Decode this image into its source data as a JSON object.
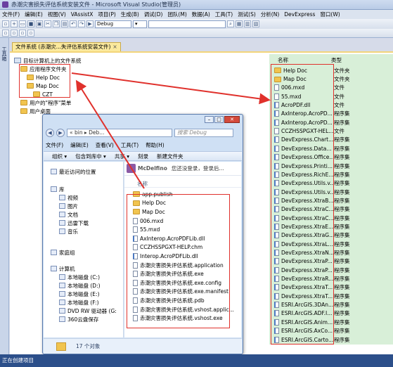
{
  "window": {
    "title": "赤潮灾害损失评估系统安装文件 - Microsoft Visual Studio(管理员)"
  },
  "menu": [
    "文件(F)",
    "编辑(E)",
    "视图(V)",
    "VAssistX",
    "项目(P)",
    "生成(B)",
    "调试(D)",
    "团队(M)",
    "数据(A)",
    "工具(T)",
    "测试(S)",
    "分析(N)",
    "DevExpress",
    "窗口(W)"
  ],
  "toolbar": {
    "config_value": "Debug"
  },
  "dock": {
    "toolbox_label": "工具箱"
  },
  "doc_tab": {
    "label": "文件系统 (赤潮灾...失评估系统安装文件)",
    "close": "×"
  },
  "fs_tree": [
    {
      "label": "目标计算机上的文件系统",
      "level": 0,
      "icon": "computer"
    },
    {
      "label": "应用程序文件夹",
      "level": 1,
      "icon": "folder"
    },
    {
      "label": "Help Doc",
      "level": 2,
      "icon": "folder"
    },
    {
      "label": "Map Doc",
      "level": 2,
      "icon": "folder"
    },
    {
      "label": "CZT",
      "level": 3,
      "icon": "folder"
    },
    {
      "label": "用户的\"程序\"菜单",
      "level": 1,
      "icon": "folder"
    },
    {
      "label": "用户桌面",
      "level": 1,
      "icon": "folder"
    }
  ],
  "right_list": {
    "col_name": "名称",
    "col_type": "类型",
    "rows": [
      {
        "name": "Help Doc",
        "type": "文件夹",
        "icon": "folder"
      },
      {
        "name": "Map Doc",
        "type": "文件夹",
        "icon": "folder"
      },
      {
        "name": "006.mxd",
        "type": "文件",
        "icon": "file"
      },
      {
        "name": "55.mxd",
        "type": "文件",
        "icon": "file"
      },
      {
        "name": "AcroPDF.dll",
        "type": "文件",
        "icon": "dll"
      },
      {
        "name": "AxInterop.AcroPD...",
        "type": "程序集",
        "icon": "dll"
      },
      {
        "name": "AxInterop.AcroPD...",
        "type": "程序集",
        "icon": "dll"
      },
      {
        "name": "CCZHSSPGXT-HEL...",
        "type": "文件",
        "icon": "file"
      },
      {
        "name": "DevExpress.Chart...",
        "type": "程序集",
        "icon": "dll"
      },
      {
        "name": "DevExpress.Data...",
        "type": "程序集",
        "icon": "dll"
      },
      {
        "name": "DevExpress.Office...",
        "type": "程序集",
        "icon": "dll"
      },
      {
        "name": "DevExpress.Printi...",
        "type": "程序集",
        "icon": "dll"
      },
      {
        "name": "DevExpress.RichE...",
        "type": "程序集",
        "icon": "dll"
      },
      {
        "name": "DevExpress.Utils.v...",
        "type": "程序集",
        "icon": "dll"
      },
      {
        "name": "DevExpress.Utils.v...",
        "type": "程序集",
        "icon": "dll"
      },
      {
        "name": "DevExpress.XtraB...",
        "type": "程序集",
        "icon": "dll"
      },
      {
        "name": "DevExpress.XtraC...",
        "type": "程序集",
        "icon": "dll"
      },
      {
        "name": "DevExpress.XtraC...",
        "type": "程序集",
        "icon": "dll"
      },
      {
        "name": "DevExpress.XtraE...",
        "type": "程序集",
        "icon": "dll"
      },
      {
        "name": "DevExpress.XtraG...",
        "type": "程序集",
        "icon": "dll"
      },
      {
        "name": "DevExpress.XtraL...",
        "type": "程序集",
        "icon": "dll"
      },
      {
        "name": "DevExpress.XtraN...",
        "type": "程序集",
        "icon": "dll"
      },
      {
        "name": "DevExpress.XtraP...",
        "type": "程序集",
        "icon": "dll"
      },
      {
        "name": "DevExpress.XtraP...",
        "type": "程序集",
        "icon": "dll"
      },
      {
        "name": "DevExpress.XtraR...",
        "type": "程序集",
        "icon": "dll"
      },
      {
        "name": "DevExpress.XtraT...",
        "type": "程序集",
        "icon": "dll"
      },
      {
        "name": "DevExpress.XtraT...",
        "type": "程序集",
        "icon": "dll"
      },
      {
        "name": "ESRI.ArcGIS.3DAn...",
        "type": "程序集",
        "icon": "dll"
      },
      {
        "name": "ESRI.ArcGIS.ADF.I...",
        "type": "程序集",
        "icon": "dll"
      },
      {
        "name": "ESRI.ArcGIS.Anim...",
        "type": "程序集",
        "icon": "dll"
      },
      {
        "name": "ESRI.ArcGIS.AxCo...",
        "type": "程序集",
        "icon": "dll"
      },
      {
        "name": "ESRI.ArcGIS.Carto...",
        "type": "程序集",
        "icon": "dll"
      }
    ]
  },
  "explorer": {
    "address": "« bin ▸ Deb...",
    "search_placeholder": "搜索 Debug",
    "menu": [
      "文件(F)",
      "编辑(E)",
      "查看(V)",
      "工具(T)",
      "帮助(H)"
    ],
    "commands": [
      "组织 ▾",
      "包含到库中 ▾",
      "共享 ▾",
      "刻录",
      "新建文件夹"
    ],
    "nav": [
      {
        "label": "最近访问的位置",
        "indent": 0
      },
      {
        "label": "库",
        "indent": 0
      },
      {
        "label": "视频",
        "indent": 1
      },
      {
        "label": "图片",
        "indent": 1
      },
      {
        "label": "文档",
        "indent": 1
      },
      {
        "label": "迅雷下载",
        "indent": 1
      },
      {
        "label": "音乐",
        "indent": 1
      },
      {
        "label": "家庭组",
        "indent": 0
      },
      {
        "label": "计算机",
        "indent": 0
      },
      {
        "label": "本地磁盘 (C:)",
        "indent": 1
      },
      {
        "label": "本地磁盘 (D:)",
        "indent": 1
      },
      {
        "label": "本地磁盘 (E:)",
        "indent": 1
      },
      {
        "label": "本地磁盘 (F:)",
        "indent": 1
      },
      {
        "label": "DVD RW 驱动器 (G:",
        "indent": 1
      },
      {
        "label": "360云盘保存",
        "indent": 1
      }
    ],
    "qq": {
      "name": "McDelfino",
      "info": "您还没登录，登录后..."
    },
    "col_name": "名称",
    "files": [
      {
        "name": "app.publish",
        "icon": "folder"
      },
      {
        "name": "Help Doc",
        "icon": "folder"
      },
      {
        "name": "Map Doc",
        "icon": "folder"
      },
      {
        "name": "006.mxd",
        "icon": "file"
      },
      {
        "name": "55.mxd",
        "icon": "file"
      },
      {
        "name": "AxInterop.AcroPDFLib.dll",
        "icon": "dll"
      },
      {
        "name": "CCZHSSPGXT-HELP.chm",
        "icon": "file"
      },
      {
        "name": "Interop.AcroPDFLib.dll",
        "icon": "dll"
      },
      {
        "name": "赤潮灾害损失评估系统.application",
        "icon": "file"
      },
      {
        "name": "赤潮灾害损失评估系统.exe",
        "icon": "file"
      },
      {
        "name": "赤潮灾害损失评估系统.exe.config",
        "icon": "file"
      },
      {
        "name": "赤潮灾害损失评估系统.exe.manifest",
        "icon": "file"
      },
      {
        "name": "赤潮灾害损失评估系统.pdb",
        "icon": "file"
      },
      {
        "name": "赤潮灾害损失评估系统.vshost.applic...",
        "icon": "file"
      },
      {
        "name": "赤潮灾害损失评估系统.vshost.exe",
        "icon": "file"
      }
    ],
    "status": "17 个对象"
  },
  "statusbar": {
    "text": "正在创建项目"
  },
  "colors": {
    "right_bg": "#d8efd8",
    "annotation_red": "#e0312c",
    "status_bg": "#2c4f8a"
  }
}
